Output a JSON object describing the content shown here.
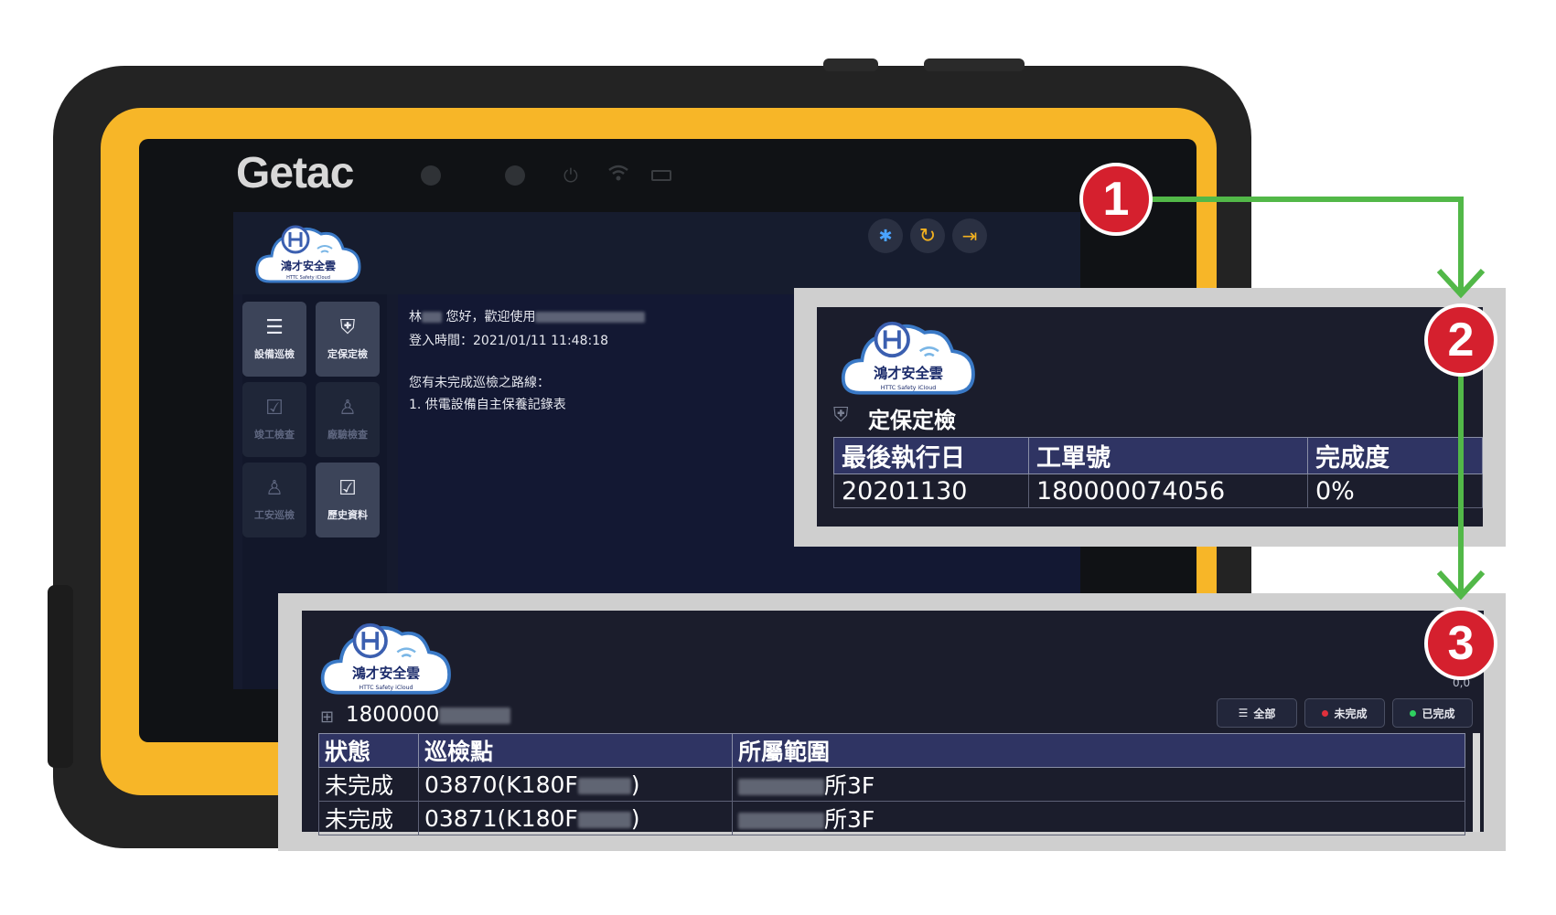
{
  "tablet": {
    "brand": "Getac"
  },
  "app": {
    "logo_text": "鴻才安全雲",
    "logo_subtext": "HTTC Safety iCloud",
    "top_icons": [
      "bluetooth-icon",
      "refresh-icon",
      "logout-icon"
    ],
    "menu": [
      {
        "label": "設備巡檢",
        "icon": "checklist-search-icon",
        "enabled": true
      },
      {
        "label": "定保定檢",
        "icon": "shield-check-icon",
        "enabled": true
      },
      {
        "label": "竣工檢查",
        "icon": "calendar-check-icon",
        "enabled": false
      },
      {
        "label": "廠驗檢查",
        "icon": "worker-icon",
        "enabled": false
      },
      {
        "label": "工安巡檢",
        "icon": "safety-worker-icon",
        "enabled": false
      },
      {
        "label": "歷史資料",
        "icon": "history-calendar-icon",
        "enabled": true
      }
    ],
    "welcome": {
      "name_prefix": "林",
      "greeting_mid": "您好，歡迎使用",
      "login_label": "登入時間：",
      "login_time": "2021/01/11 11:48:18",
      "unfinished_notice": "您有未完成巡檢之路線：",
      "route_1": "1. 供電設備自主保養記錄表"
    }
  },
  "callouts": {
    "step1": "1",
    "step2": "2",
    "step3": "3"
  },
  "panel2": {
    "section_title": "定保定檢",
    "headers": [
      "最後執行日",
      "工單號",
      "完成度"
    ],
    "row": {
      "date": "20201130",
      "order": "180000074056",
      "progress": "0%"
    }
  },
  "panel3": {
    "order_prefix": "1800000",
    "corner_text": "0,0",
    "filters": [
      {
        "label": "全部",
        "icon": "list-icon"
      },
      {
        "label": "未完成",
        "icon": "red-dot",
        "color": "#e0303c"
      },
      {
        "label": "已完成",
        "icon": "green-dot",
        "color": "#2fd060"
      }
    ],
    "headers": [
      "狀態",
      "巡檢點",
      "所屬範圍"
    ],
    "rows": [
      {
        "status": "未完成",
        "point_prefix": "03870(K180F",
        "point_suffix": ")",
        "area_suffix": "所3F"
      },
      {
        "status": "未完成",
        "point_prefix": "03871(K180F",
        "point_suffix": ")",
        "area_suffix": "所3F"
      }
    ]
  },
  "colors": {
    "bumper": "#f7b628",
    "marker": "#d5202e",
    "arrow": "#52b848",
    "panel_bg": "#1b1d2c",
    "table_header": "#2f3463"
  }
}
